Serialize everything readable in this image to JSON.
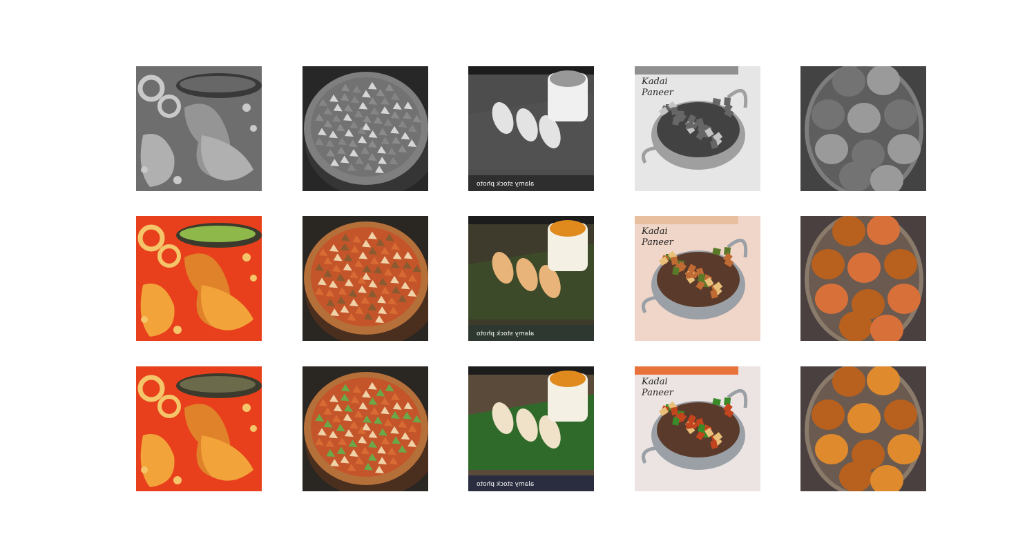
{
  "rows": [
    {
      "mode": "grayscale"
    },
    {
      "mode": "colorized"
    },
    {
      "mode": "original"
    }
  ],
  "columns": [
    {
      "subject": "calamari and mussels with pasta",
      "overlay": ""
    },
    {
      "subject": "loaded pizza",
      "overlay": ""
    },
    {
      "subject": "momos with dipping sauce",
      "overlay": "alamy stock photo"
    },
    {
      "subject": "kadai paneer",
      "overlay_line1": "Kadai",
      "overlay_line2": "Paneer"
    },
    {
      "subject": "fried patties on platter",
      "overlay": ""
    }
  ],
  "colors": {
    "background": "#ffffff"
  }
}
